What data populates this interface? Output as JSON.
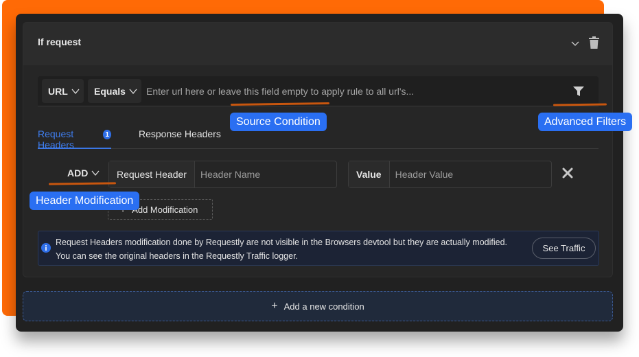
{
  "card": {
    "title": "If request"
  },
  "source": {
    "type_value": "URL",
    "operator_value": "Equals",
    "url_placeholder": "Enter url here or leave this field empty to apply rule to all url's...",
    "url_value": ""
  },
  "tabs": [
    {
      "label": "Request Headers",
      "badge": "1",
      "active": true
    },
    {
      "label": "Response Headers",
      "active": false
    }
  ],
  "modification": {
    "action_value": "ADD",
    "header_addon": "Request Header",
    "header_name_placeholder": "Header Name",
    "value_addon": "Value",
    "header_value_placeholder": "Header Value"
  },
  "add_modification_label": "Add Modification",
  "info": {
    "line1": "Request Headers modification done by Requestly are not visible in the Browsers devtool but they are actually modified.",
    "line2": "You can see the original headers in the Requestly Traffic logger.",
    "button_label": "See Traffic"
  },
  "add_condition_label": "Add a new condition",
  "callouts": {
    "source_condition": "Source Condition",
    "advanced_filters": "Advanced Filters",
    "header_modification": "Header Modification"
  },
  "colors": {
    "accent": "#2a6ff2",
    "brand_orange": "#ff6a06",
    "annotation_underline": "#c8560e"
  }
}
